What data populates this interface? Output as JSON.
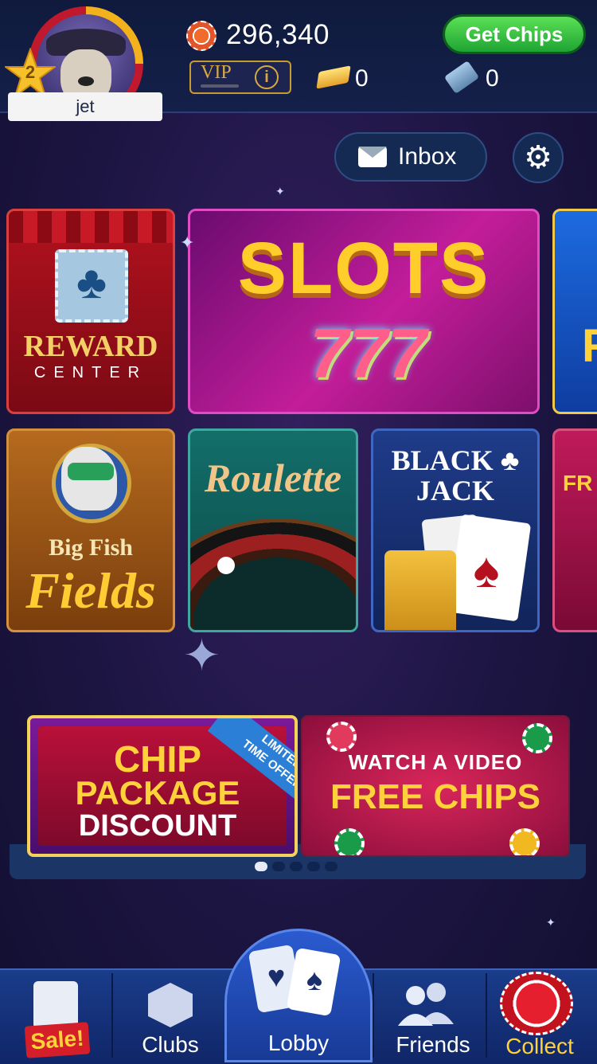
{
  "header": {
    "level": "2",
    "username": "jet",
    "chip_balance": "296,340",
    "get_chips_label": "Get Chips",
    "vip_label": "VIP",
    "vip_info_glyph": "i",
    "gold_count": "0",
    "ticket_count": "0"
  },
  "toolbar": {
    "inbox_label": "Inbox",
    "settings_glyph": "⚙"
  },
  "tiles": {
    "reward_title": "REWARD",
    "reward_subtitle": "CENTER",
    "slots_title": "SLOTS",
    "slots_sevens": "777",
    "horse_line1": "Big Fish",
    "horse_line2": "Fields",
    "roulette_title": "Roulette",
    "blackjack_line1": "BLACK ♣",
    "blackjack_line2": "JACK",
    "partial_top_letter": "F",
    "partial_mid_text": "FR"
  },
  "promos": {
    "chip_line1": "CHIP",
    "chip_line2": "PACKAGE",
    "chip_line3": "DISCOUNT",
    "limited_line1": "LIMITED",
    "limited_line2": "TIME OFFER",
    "video_line1": "WATCH A VIDEO",
    "video_line2": "FREE CHIPS",
    "page_count": 5,
    "active_page": 0
  },
  "nav": {
    "sale_label": "Sale!",
    "clubs_label": "Clubs",
    "lobby_label": "Lobby",
    "friends_label": "Friends",
    "collect_label": "Collect"
  },
  "colors": {
    "accent_gold": "#ffd23a",
    "get_chips_green": "#1fa434",
    "nav_blue": "#1a3c8a",
    "sale_red": "#d41e2a"
  }
}
